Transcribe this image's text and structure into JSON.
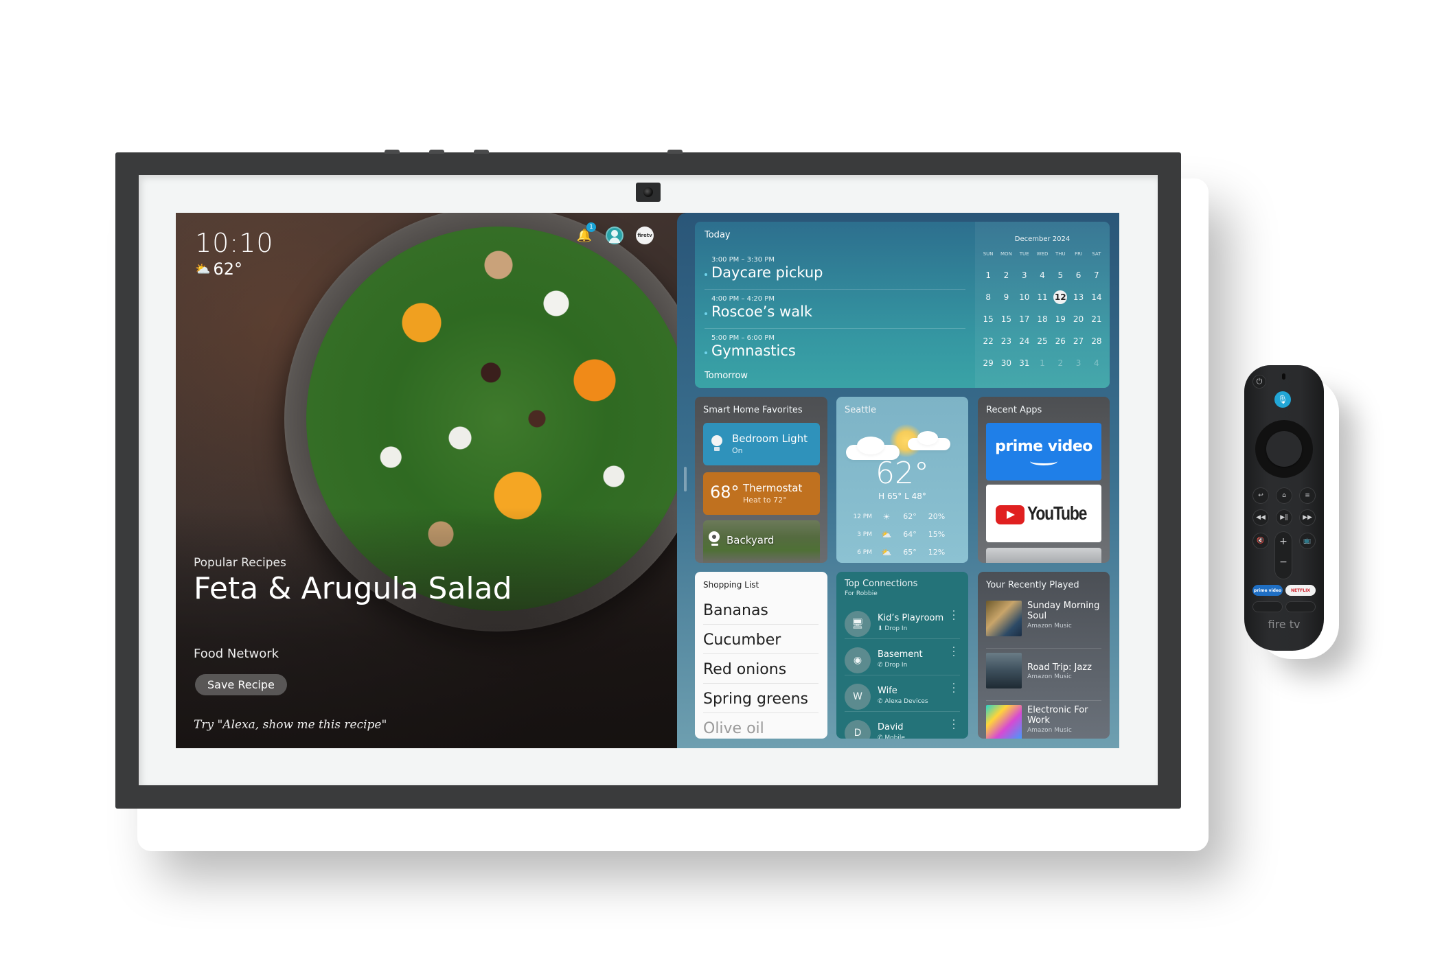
{
  "device": {
    "product": "Echo Show display with Fire TV remote"
  },
  "status_bar": {
    "time": "10:10",
    "temperature": "62°",
    "weather_icon": "partly-cloudy-icon",
    "notification_count": "1",
    "icons": [
      "bell-icon",
      "profile-avatar-icon",
      "firetv-icon"
    ],
    "firetv_label": "firetv"
  },
  "recipe": {
    "category": "Popular Recipes",
    "title": "Feta & Arugula Salad",
    "source": "Food Network",
    "save_label": "Save Recipe",
    "hint": "Try \"Alexa, show me this recipe\""
  },
  "calendar": {
    "today_label": "Today",
    "tomorrow_label": "Tomorrow",
    "events": [
      {
        "time": "3:00 PM – 3:30 PM",
        "name": "Daycare pickup"
      },
      {
        "time": "4:00 PM – 4:20 PM",
        "name": "Roscoe’s walk"
      },
      {
        "time": "5:00 PM – 6:00 PM",
        "name": "Gymnastics"
      }
    ],
    "month": "December 2024",
    "weekdays": [
      "SUN",
      "MON",
      "TUE",
      "WED",
      "THU",
      "FRI",
      "SAT"
    ],
    "weeks": [
      [
        "1",
        "2",
        "3",
        "4",
        "5",
        "6",
        "7"
      ],
      [
        "8",
        "9",
        "10",
        "11",
        "12",
        "13",
        "14"
      ],
      [
        "15",
        "15",
        "17",
        "18",
        "19",
        "20",
        "21"
      ],
      [
        "22",
        "23",
        "24",
        "25",
        "26",
        "27",
        "28"
      ],
      [
        "29",
        "30",
        "31",
        "1",
        "2",
        "3",
        "4"
      ]
    ],
    "selected_day": "12",
    "muted_trailing_days": 4
  },
  "smart_home": {
    "title": "Smart Home Favorites",
    "light": {
      "name": "Bedroom Light",
      "state": "On"
    },
    "thermostat": {
      "temp": "68°",
      "name": "Thermostat",
      "setting": "Heat to 72°"
    },
    "camera": {
      "name": "Backyard"
    },
    "colors": {
      "light": "#2f92bb",
      "thermostat": "#c0711f"
    }
  },
  "weather": {
    "city": "Seattle",
    "current": "62°",
    "high_low": "H 65°  L 48°",
    "hourly": [
      {
        "time": "12 PM",
        "icon": "sun-icon",
        "temp": "62°",
        "precip": "20%"
      },
      {
        "time": "3 PM",
        "icon": "partly-cloudy-icon",
        "temp": "64°",
        "precip": "15%"
      },
      {
        "time": "6 PM",
        "icon": "partly-cloudy-icon",
        "temp": "65°",
        "precip": "12%"
      }
    ]
  },
  "recent_apps": {
    "title": "Recent Apps",
    "apps": [
      {
        "name": "prime video",
        "color": "#1f7fe8"
      },
      {
        "name": "YouTube",
        "color": "#e02020"
      }
    ]
  },
  "shopping_list": {
    "title": "Shopping List",
    "items": [
      "Bananas",
      "Cucumber",
      "Red onions",
      "Spring greens",
      "Olive oil"
    ]
  },
  "connections": {
    "title": "Top Connections",
    "subtitle": "For Robbie",
    "contacts": [
      {
        "name": "Kid’s Playroom",
        "detail": "Drop In",
        "avatar": "monitor-icon",
        "detail_icon": "drop-in-icon"
      },
      {
        "name": "Basement",
        "detail": "Drop In",
        "avatar": "echo-dot-icon",
        "detail_icon": "phone-icon"
      },
      {
        "name": "Wife",
        "detail": "Alexa Devices",
        "avatar": "W",
        "detail_icon": "phone-icon"
      },
      {
        "name": "David",
        "detail": "Mobile",
        "avatar": "D",
        "detail_icon": "phone-icon"
      }
    ]
  },
  "recently_played": {
    "title": "Your Recently Played",
    "tracks": [
      {
        "title": "Sunday Morning Soul",
        "source": "Amazon Music"
      },
      {
        "title": "Road Trip: Jazz",
        "source": "Amazon Music"
      },
      {
        "title": "Electronic For Work",
        "source": "Amazon Music"
      }
    ]
  },
  "remote": {
    "buttons": [
      "power",
      "microphone",
      "navigation-ring",
      "select",
      "back",
      "home",
      "menu",
      "rewind",
      "play-pause",
      "fast-forward",
      "mute",
      "volume-up",
      "volume-down",
      "live-tv"
    ],
    "prime_label": "prime video",
    "netflix_label": "NETFLIX",
    "logo": "fire tv",
    "mic_color": "#22a6d6"
  }
}
